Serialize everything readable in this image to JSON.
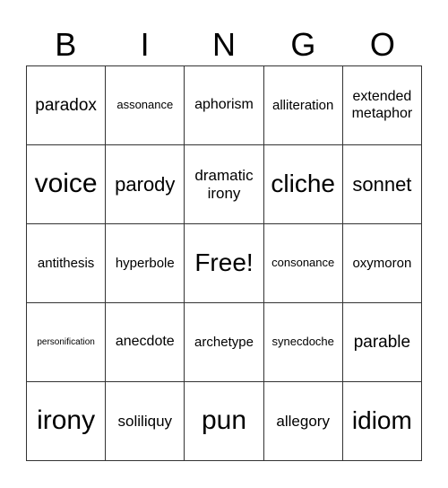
{
  "header": [
    "B",
    "I",
    "N",
    "G",
    "O"
  ],
  "cells": [
    [
      "paradox",
      "assonance",
      "aphorism",
      "alliteration",
      "extended metaphor"
    ],
    [
      "voice",
      "parody",
      "dramatic irony",
      "cliche",
      "sonnet"
    ],
    [
      "antithesis",
      "hyperbole",
      "Free!",
      "consonance",
      "oxymoron"
    ],
    [
      "personification",
      "anecdote",
      "archetype",
      "synecdoche",
      "parable"
    ],
    [
      "irony",
      "soliliquy",
      "pun",
      "allegory",
      "idiom"
    ]
  ]
}
